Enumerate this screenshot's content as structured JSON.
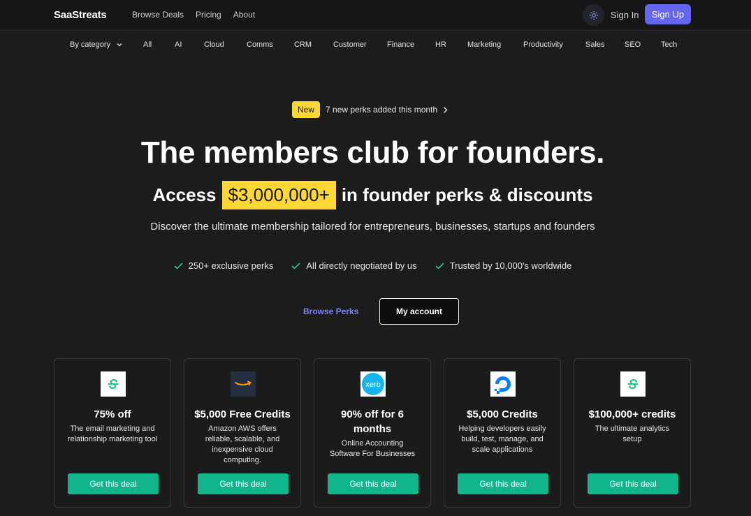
{
  "header": {
    "logo": "SaaStreats",
    "nav": [
      "Browse Deals",
      "Pricing",
      "About"
    ],
    "signin": "Sign In",
    "signup": "Sign Up"
  },
  "categories": {
    "dropdown_label": "By category",
    "items": [
      "All",
      "AI",
      "Cloud",
      "Comms",
      "CRM",
      "Customer",
      "Finance",
      "HR",
      "Marketing",
      "Productivity",
      "Sales",
      "SEO",
      "Tech"
    ]
  },
  "announcement": {
    "badge": "New",
    "text": "7 new perks added this month"
  },
  "hero": {
    "title": "The members club for founders.",
    "sub_prefix": "Access",
    "sub_highlight": "$3,000,000+",
    "sub_suffix": "in founder perks & discounts",
    "description": "Discover the ultimate membership tailored for entrepreneurs, businesses, startups and founders"
  },
  "features": [
    "250+ exclusive perks",
    "All directly negotiated by us",
    "Trusted by 10,000's worldwide"
  ],
  "actions": {
    "browse": "Browse Perks",
    "account": "My account"
  },
  "cards": [
    {
      "logo": "sendfox-icon",
      "title": "75% off",
      "description": "The email marketing and relationship marketing tool",
      "button": "Get this deal"
    },
    {
      "logo": "amazon-aws-icon",
      "title": "$5,000 Free Credits",
      "description": "Amazon AWS offers reliable, scalable, and inexpensive cloud computing.",
      "button": "Get this deal"
    },
    {
      "logo": "xero-icon",
      "title": "90% off for 6 months",
      "description": "Online Accounting Software For Businesses",
      "button": "Get this deal"
    },
    {
      "logo": "digitalocean-icon",
      "title": "$5,000 Credits",
      "description": "Helping developers easily build, test, manage, and scale applications",
      "button": "Get this deal"
    },
    {
      "logo": "segment-icon",
      "title": "$100,000+ credits",
      "description": "The ultimate analytics setup",
      "button": "Get this deal"
    }
  ],
  "colors": {
    "background": "#1c1c1c",
    "accent": "#6466f1",
    "highlight": "#fcd735",
    "cta": "#11b58b"
  }
}
